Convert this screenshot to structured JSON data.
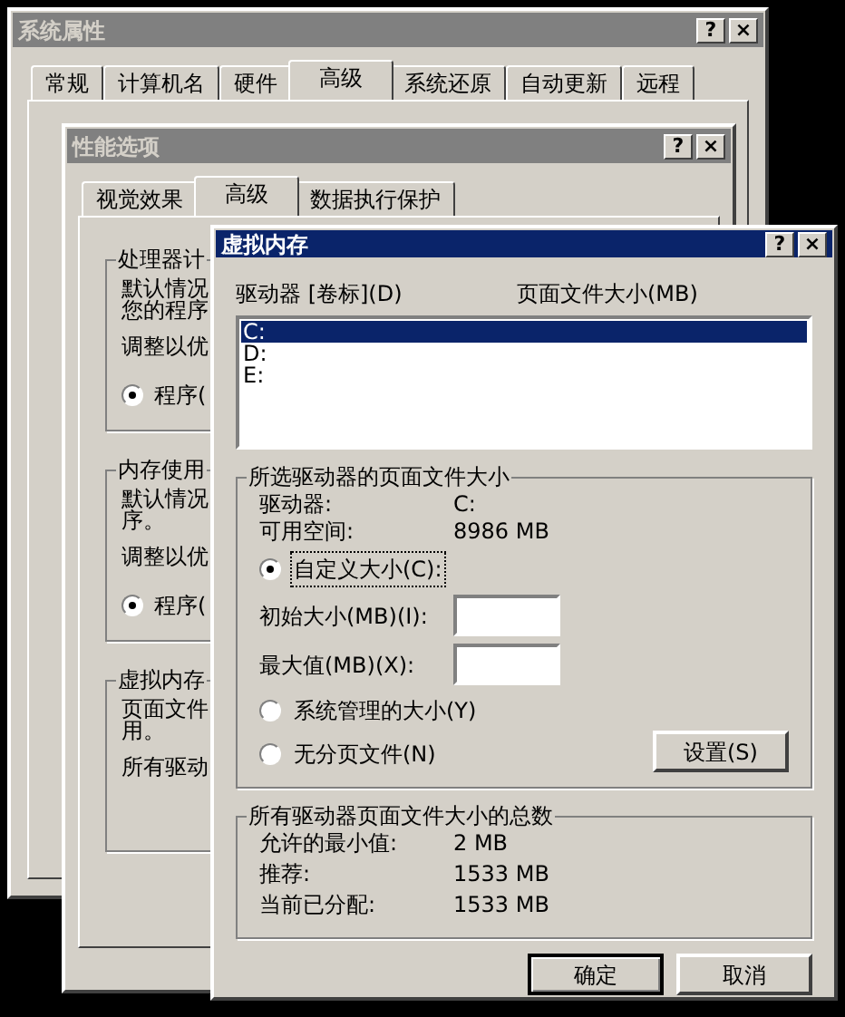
{
  "system_properties": {
    "title": "系统属性",
    "active": false,
    "title_buttons": [
      "?",
      "×"
    ],
    "tabs": [
      {
        "label": "常规",
        "selected": false
      },
      {
        "label": "计算机名",
        "selected": false
      },
      {
        "label": "硬件",
        "selected": false
      },
      {
        "label": "高级",
        "selected": true
      },
      {
        "label": "系统还原",
        "selected": false
      },
      {
        "label": "自动更新",
        "selected": false
      },
      {
        "label": "远程",
        "selected": false
      }
    ]
  },
  "performance_options": {
    "title": "性能选项",
    "active": false,
    "title_buttons": [
      "?",
      "×"
    ],
    "tabs": [
      {
        "label": "视觉效果",
        "selected": false
      },
      {
        "label": "高级",
        "selected": true
      },
      {
        "label": "数据执行保护",
        "selected": false
      }
    ],
    "groups": [
      {
        "title": "处理器计",
        "paragraphs": [
          [
            "默认情况",
            "您的程序"
          ],
          [
            "调整以优"
          ]
        ],
        "radio": {
          "label": "程序(",
          "selected": true
        }
      },
      {
        "title": "内存使用",
        "paragraphs": [
          [
            "默认情况",
            "序。"
          ],
          [
            "调整以优"
          ]
        ],
        "radio": {
          "label": "程序(",
          "selected": true
        }
      },
      {
        "title": "虚拟内存",
        "paragraphs": [
          [
            "页面文件",
            "用。"
          ],
          [
            "所有驱动"
          ]
        ]
      }
    ]
  },
  "virtual_memory": {
    "title": "虚拟内存",
    "active": true,
    "title_buttons": [
      "?",
      "×"
    ],
    "columns": [
      "驱动器 [卷标](D)",
      "页面文件大小(MB)"
    ],
    "drives": [
      {
        "name": "C:",
        "selected": true
      },
      {
        "name": "D:",
        "selected": false
      },
      {
        "name": "E:",
        "selected": false
      }
    ],
    "selected_drive": {
      "title": "所选驱动器的页面文件大小",
      "info": [
        {
          "label": "驱动器:",
          "value": "C:"
        },
        {
          "label": "可用空间:",
          "value": "8986 MB"
        }
      ],
      "options": [
        {
          "kind": "radio",
          "label": "自定义大小(C):",
          "selected": true,
          "focused": true
        },
        {
          "kind": "field",
          "label": "初始大小(MB)(I):"
        },
        {
          "kind": "field",
          "label": "最大值(MB)(X):"
        },
        {
          "kind": "radio",
          "label": "系统管理的大小(Y)",
          "selected": false,
          "focused": false
        },
        {
          "kind": "radio",
          "label": "无分页文件(N)",
          "selected": false,
          "focused": false
        }
      ],
      "set_button": "设置(S)"
    },
    "totals": {
      "title": "所有驱动器页面文件大小的总数",
      "rows": [
        {
          "label": "允许的最小值:",
          "value": "2 MB"
        },
        {
          "label": "推荐:",
          "value": "1533 MB"
        },
        {
          "label": "当前已分配:",
          "value": "1533 MB"
        }
      ]
    },
    "buttons": [
      "确定",
      "取消"
    ]
  }
}
